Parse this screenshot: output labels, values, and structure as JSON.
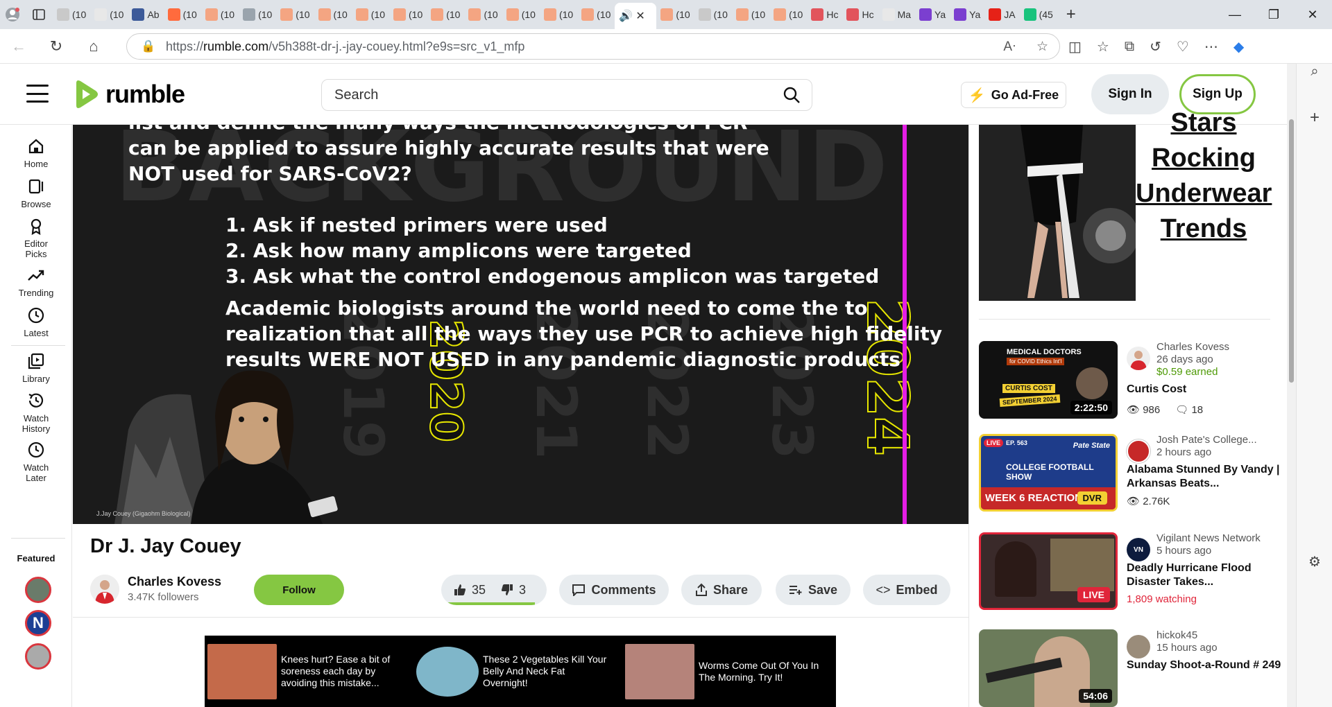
{
  "browser": {
    "tabs": [
      {
        "label": "(10",
        "color": "#c9c9c9"
      },
      {
        "label": "(10",
        "color": "#e8e8e8"
      },
      {
        "label": "Ab",
        "color": "#3c5a99"
      },
      {
        "label": "(10",
        "color": "#ff6b3d"
      },
      {
        "label": "(10",
        "color": "#f4a582"
      },
      {
        "label": "(10",
        "color": "#9aa4ad"
      },
      {
        "label": "(10",
        "color": "#f4a582"
      },
      {
        "label": "(10",
        "color": "#f4a582"
      },
      {
        "label": "(10",
        "color": "#f4a582"
      },
      {
        "label": "(10",
        "color": "#f4a582"
      },
      {
        "label": "(10",
        "color": "#f4a582"
      },
      {
        "label": "(10",
        "color": "#f4a582"
      },
      {
        "label": "(10",
        "color": "#f4a582"
      },
      {
        "label": "(10",
        "color": "#f4a582"
      },
      {
        "label": "(10",
        "color": "#f4a582"
      }
    ],
    "tabs_right": [
      {
        "label": "(10",
        "color": "#f4a582"
      },
      {
        "label": "(10",
        "color": "#c9c9c9"
      },
      {
        "label": "(10",
        "color": "#f4a582"
      },
      {
        "label": "(10",
        "color": "#f4a582"
      },
      {
        "label": "Hc",
        "color": "#e2545c"
      },
      {
        "label": "Hc",
        "color": "#e2545c"
      },
      {
        "label": "Ma",
        "color": "#e8e8e8"
      },
      {
        "label": "Ya",
        "color": "#7b3fd0"
      },
      {
        "label": "Ya",
        "color": "#7b3fd0"
      },
      {
        "label": "JA",
        "color": "#e62117"
      },
      {
        "label": "(45",
        "color": "#19c37d"
      }
    ],
    "url_prefix": "https://",
    "url_host": "rumble.com",
    "url_path": "/v5h388t-dr-j.-jay-couey.html?e9s=src_v1_mfp"
  },
  "header": {
    "logo_text": "rumble",
    "search_placeholder": "Search",
    "go_ad_free": "Go Ad-Free",
    "sign_in": "Sign In",
    "sign_up": "Sign Up"
  },
  "nav": {
    "items": [
      {
        "label": "Home",
        "icon": "home-icon"
      },
      {
        "label": "Browse",
        "icon": "browse-icon"
      },
      {
        "label": "Editor Picks",
        "icon": "editor-picks-icon"
      },
      {
        "label": "Trending",
        "icon": "trending-icon"
      },
      {
        "label": "Latest",
        "icon": "clock-icon"
      },
      {
        "label": "Library",
        "icon": "library-icon"
      },
      {
        "label": "Watch History",
        "icon": "history-icon"
      },
      {
        "label": "Watch Later",
        "icon": "clock-icon"
      }
    ],
    "featured_label": "Featured"
  },
  "video": {
    "slide_lines": [
      "list and define the many ways the methodologies of PCR",
      "can be applied to assure highly accurate results that were",
      "NOT used for SARS-CoV2?"
    ],
    "slide_list": [
      "1.  Ask if nested primers were used",
      "2.  Ask how many amplicons were targeted",
      "3.  Ask what the control endogenous amplicon was targeted"
    ],
    "slide_para": [
      "Academic biologists around the world need to come the to",
      "realization that all the ways they use PCR to achieve high fidelity",
      "results WERE NOT USED in any pandemic diagnostic products"
    ],
    "years": [
      "2019",
      "2020",
      "2021",
      "2022",
      "2023",
      "2024"
    ],
    "credit": "J.Jay Couey (Gigaohm Biological)"
  },
  "details": {
    "title": "Dr J. Jay Couey",
    "channel_name": "Charles Kovess",
    "followers": "3.47K followers",
    "follow_label": "Follow",
    "likes": "35",
    "dislikes": "3",
    "like_ratio": 0.92,
    "comments_label": "Comments",
    "share_label": "Share",
    "save_label": "Save",
    "embed_label": "Embed"
  },
  "ads": [
    {
      "text": "Knees hurt? Ease a bit of soreness each day by avoiding this mistake...",
      "color": "#c46a4a"
    },
    {
      "text": "These 2 Vegetables Kill Your Belly And Neck Fat Overnight!",
      "color": "#7fb6c9"
    },
    {
      "text": "Worms Come Out Of You In The Morning. Try It!",
      "color": "#b5837a"
    }
  ],
  "sidebar_ad": {
    "headline_lines": [
      "Stars",
      "Rocking",
      "Underwear",
      "Trends"
    ]
  },
  "recommended": [
    {
      "channel": "Charles Kovess",
      "ago": "26 days ago",
      "earned": "$0.59 earned",
      "title": "Curtis Cost",
      "duration": "2:22:50",
      "views": "986",
      "comments": "18",
      "thumb_text": "MEDICAL DOCTORS",
      "thumb_sub": "for COVID Ethics Int'l",
      "thumb_name": "CURTIS COST",
      "thumb_date": "SEPTEMBER 2024"
    },
    {
      "channel": "Josh Pate's College...",
      "ago": "2 hours ago",
      "title": "Alabama Stunned By Vandy | Arkansas Beats...",
      "views": "2.76K",
      "live_badge": "LIVE",
      "episode": "EP. 563",
      "show_name": "COLLEGE FOOTBALL SHOW",
      "show_brand": "Pate State",
      "week_text": "WEEK 6 REACTION",
      "dvr": "DVR"
    },
    {
      "channel": "Vigilant News Network",
      "ago": "5 hours ago",
      "title": "Deadly Hurricane Flood Disaster Takes...",
      "watching": "1,809 watching",
      "live_badge": "LIVE"
    },
    {
      "channel": "hickok45",
      "ago": "15 hours ago",
      "title": "Sunday Shoot-a-Round # 249",
      "duration": "54:06"
    }
  ]
}
